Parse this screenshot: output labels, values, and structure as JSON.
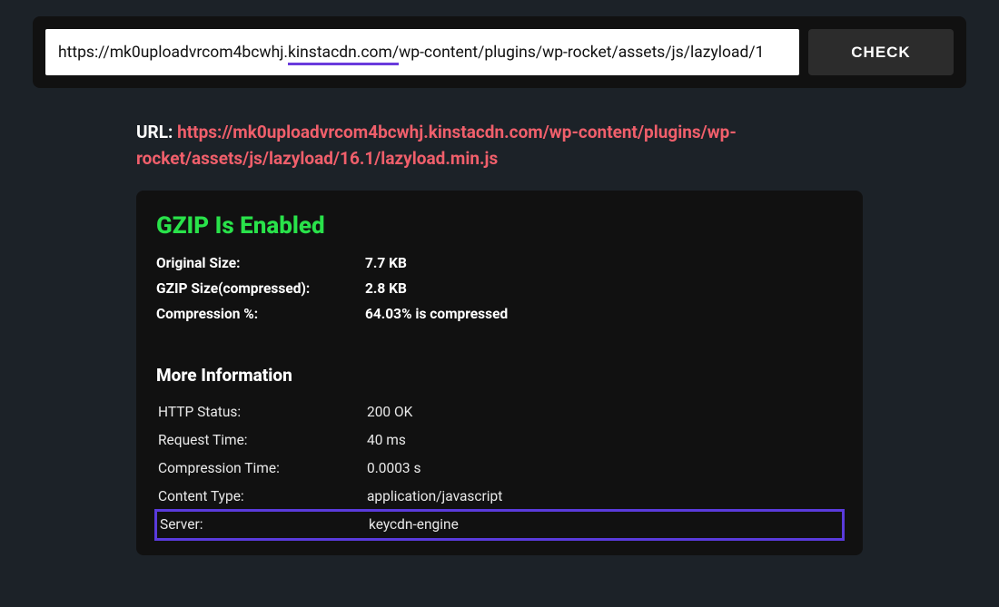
{
  "input": {
    "url_before": "https://mk0uploadvrcom4bcwhj.",
    "url_highlight": "kinstacdn.com/",
    "url_after": "wp-content/plugins/wp-rocket/assets/js/lazyload/1",
    "check_label": "CHECK"
  },
  "result": {
    "url_label": "URL:",
    "url_value": "https://mk0uploadvrcom4bcwhj.kinstacdn.com/wp-content/plugins/wp-rocket/assets/js/lazyload/16.1/lazyload.min.js",
    "gzip_heading": "GZIP Is Enabled",
    "summary": [
      {
        "k": "Original Size:",
        "v": "7.7 KB"
      },
      {
        "k": "GZIP Size(compressed):",
        "v": "2.8 KB"
      },
      {
        "k": "Compression %:",
        "v": "64.03% is compressed"
      }
    ],
    "more_info_heading": "More Information",
    "info": [
      {
        "k": "HTTP Status:",
        "v": "200 OK",
        "highlight": false
      },
      {
        "k": "Request Time:",
        "v": "40 ms",
        "highlight": false
      },
      {
        "k": "Compression Time:",
        "v": "0.0003 s",
        "highlight": false
      },
      {
        "k": "Content Type:",
        "v": "application/javascript",
        "highlight": false
      },
      {
        "k": "Server:",
        "v": "keycdn-engine",
        "highlight": true
      }
    ]
  },
  "colors": {
    "accent_green": "#29e24a",
    "accent_red": "#f05f6b",
    "accent_purple": "#5a3bdc"
  }
}
